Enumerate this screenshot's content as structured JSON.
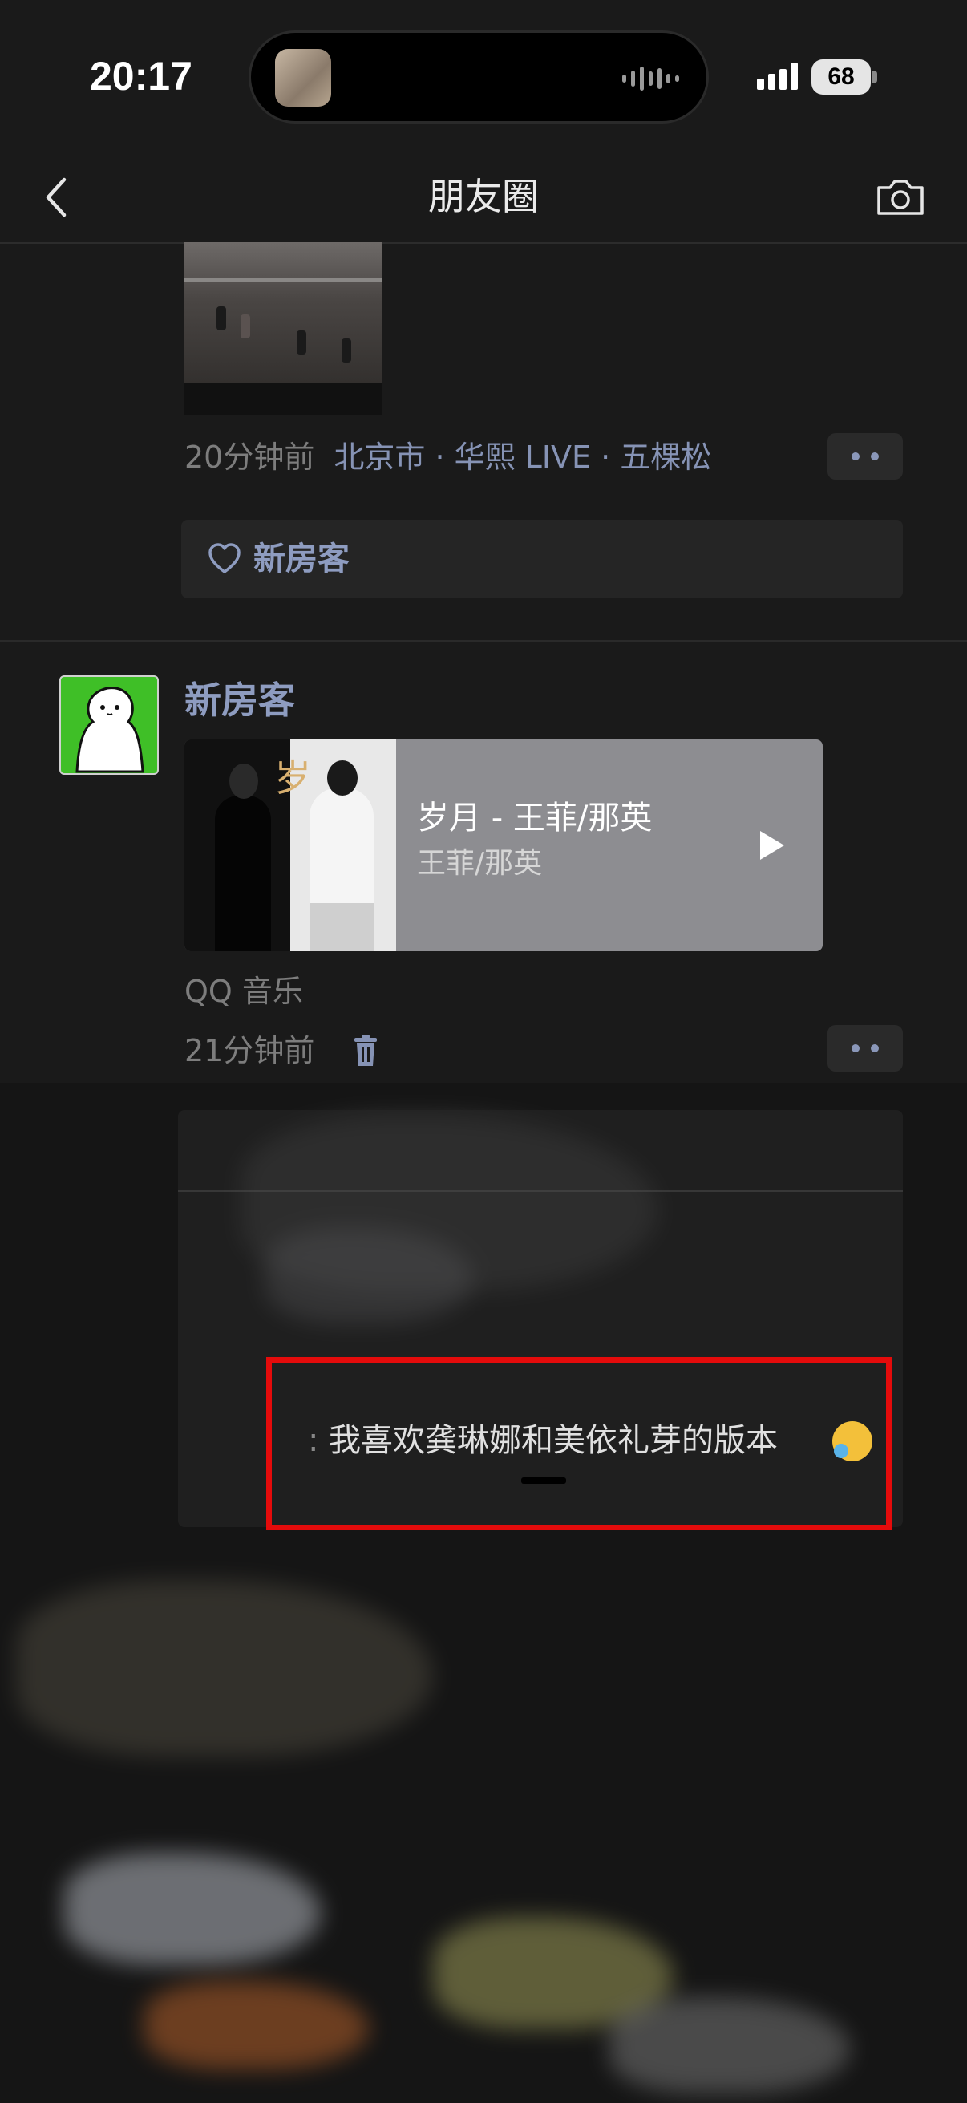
{
  "status_bar": {
    "time": "20:17",
    "battery": "68"
  },
  "nav": {
    "title": "朋友圈",
    "back_icon": "chevron-left-icon",
    "camera_icon": "camera-icon"
  },
  "post1": {
    "time_ago": "20分钟前",
    "location": "北京市 · 华熙 LIVE · 五棵松",
    "like_name": "新房客"
  },
  "post2": {
    "author": "新房客",
    "music": {
      "title": "岁月 - 王菲/那英",
      "artist": "王菲/那英"
    },
    "source": "QQ 音乐",
    "time_ago": "21分钟前"
  },
  "comment": {
    "text": "我喜欢龚琳娜和美依礼芽的版本"
  },
  "colors": {
    "link": "#8e9cc0",
    "highlight": "#e40b0b",
    "avatar_green": "#3fbf27"
  }
}
